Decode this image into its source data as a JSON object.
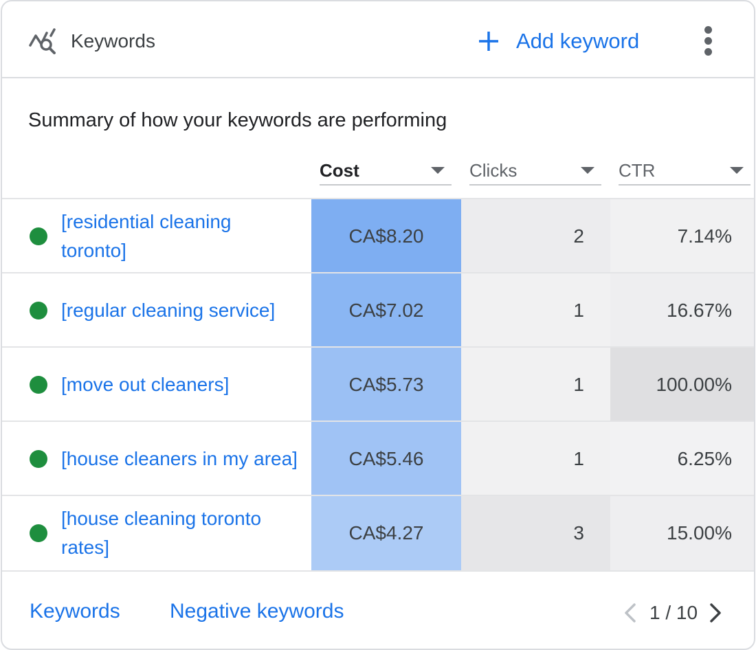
{
  "header": {
    "title": "Keywords",
    "add_label": "Add keyword",
    "icon": "keyword-search-icon",
    "menu_icon": "more-vert-icon"
  },
  "summary": "Summary of how your keywords are performing",
  "columns": {
    "cost": "Cost",
    "clicks": "Clicks",
    "ctr": "CTR"
  },
  "rows": [
    {
      "keyword": "[residential cleaning toronto]",
      "status": "enabled",
      "cost": "CA$8.20",
      "clicks": "2",
      "ctr": "7.14%",
      "cost_bg": "#7eaef2",
      "clicks_bg": "#ececee",
      "ctr_bg": "#f1f1f2"
    },
    {
      "keyword": "[regular cleaning service]",
      "status": "enabled",
      "cost": "CA$7.02",
      "clicks": "1",
      "ctr": "16.67%",
      "cost_bg": "#8ab6f3",
      "clicks_bg": "#f1f1f2",
      "ctr_bg": "#eeeef0"
    },
    {
      "keyword": "[move out cleaners]",
      "status": "enabled",
      "cost": "CA$5.73",
      "clicks": "1",
      "ctr": "100.00%",
      "cost_bg": "#9bc0f4",
      "clicks_bg": "#f1f1f2",
      "ctr_bg": "#dfdfe1"
    },
    {
      "keyword": "[house cleaners in my area]",
      "status": "enabled",
      "cost": "CA$5.46",
      "clicks": "1",
      "ctr": "6.25%",
      "cost_bg": "#a0c3f5",
      "clicks_bg": "#f1f1f2",
      "ctr_bg": "#f2f2f3"
    },
    {
      "keyword": "[house cleaning toronto rates]",
      "status": "enabled",
      "cost": "CA$4.27",
      "clicks": "3",
      "ctr": "15.00%",
      "cost_bg": "#accbf6",
      "clicks_bg": "#e6e6e8",
      "ctr_bg": "#eeeef0"
    }
  ],
  "footer": {
    "keywords_link": "Keywords",
    "negative_link": "Negative keywords",
    "page": "1 / 10"
  },
  "colors": {
    "link": "#1a73e8",
    "status_enabled": "#1e8e3e"
  }
}
